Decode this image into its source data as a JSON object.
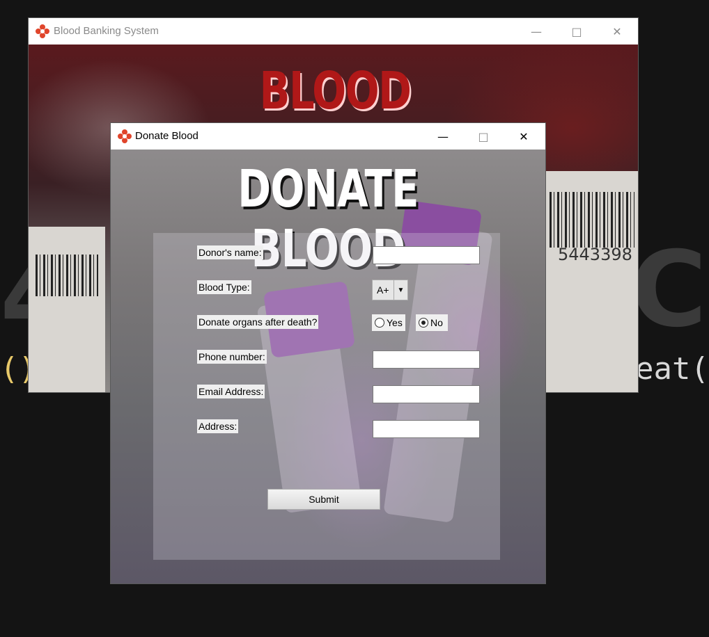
{
  "main_window": {
    "title": "Blood Banking System",
    "heading": "BLOOD BANK",
    "barcode_text": "5443398",
    "icon": "blood-drop-cross-icon"
  },
  "donate_window": {
    "title": "Donate Blood",
    "heading": "DONATE BLOOD",
    "fields": {
      "donor_name_label": "Donor's name:",
      "blood_type_label": "Blood Type:",
      "organs_label": "Donate organs after death?",
      "phone_label": "Phone number:",
      "email_label": "Email Address:",
      "address_label": "Address:"
    },
    "blood_type_value": "A+",
    "radio": {
      "yes_label": "Yes",
      "no_label": "No",
      "selected": "No"
    },
    "submit_label": "Submit"
  },
  "background_code": {
    "left_text": "()",
    "right_text": "eat("
  },
  "colors": {
    "accent_red": "#b01818",
    "brand_icon": "#e0452b"
  }
}
